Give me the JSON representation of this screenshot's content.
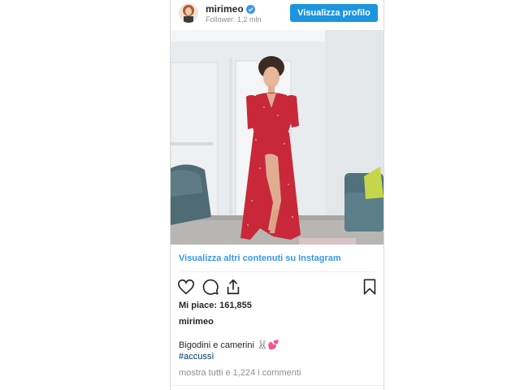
{
  "post": {
    "username": "mirimeo",
    "followers": "Follower: 1,2 mln",
    "view_profile_label": "Visualizza profilo",
    "more_content_link": "Visualizza altri contenuti su Instagram",
    "likes": "Mi piace: 161,855",
    "owner_username": "mirimeo",
    "caption": "Bigodini e camerini 🐰💕",
    "hashtag": "#accussì",
    "comments_link": "mostra tutti e 1,224 i commenti"
  },
  "icons": {
    "verified": "verified-badge-icon",
    "like": "heart-icon",
    "comment": "comment-bubble-icon",
    "share": "share-icon",
    "save": "bookmark-icon"
  },
  "colors": {
    "accent": "#1b95e0",
    "link": "#3897f0",
    "hashtag": "#003569",
    "muted": "#8e8e8e",
    "dress": "#c8283a"
  }
}
